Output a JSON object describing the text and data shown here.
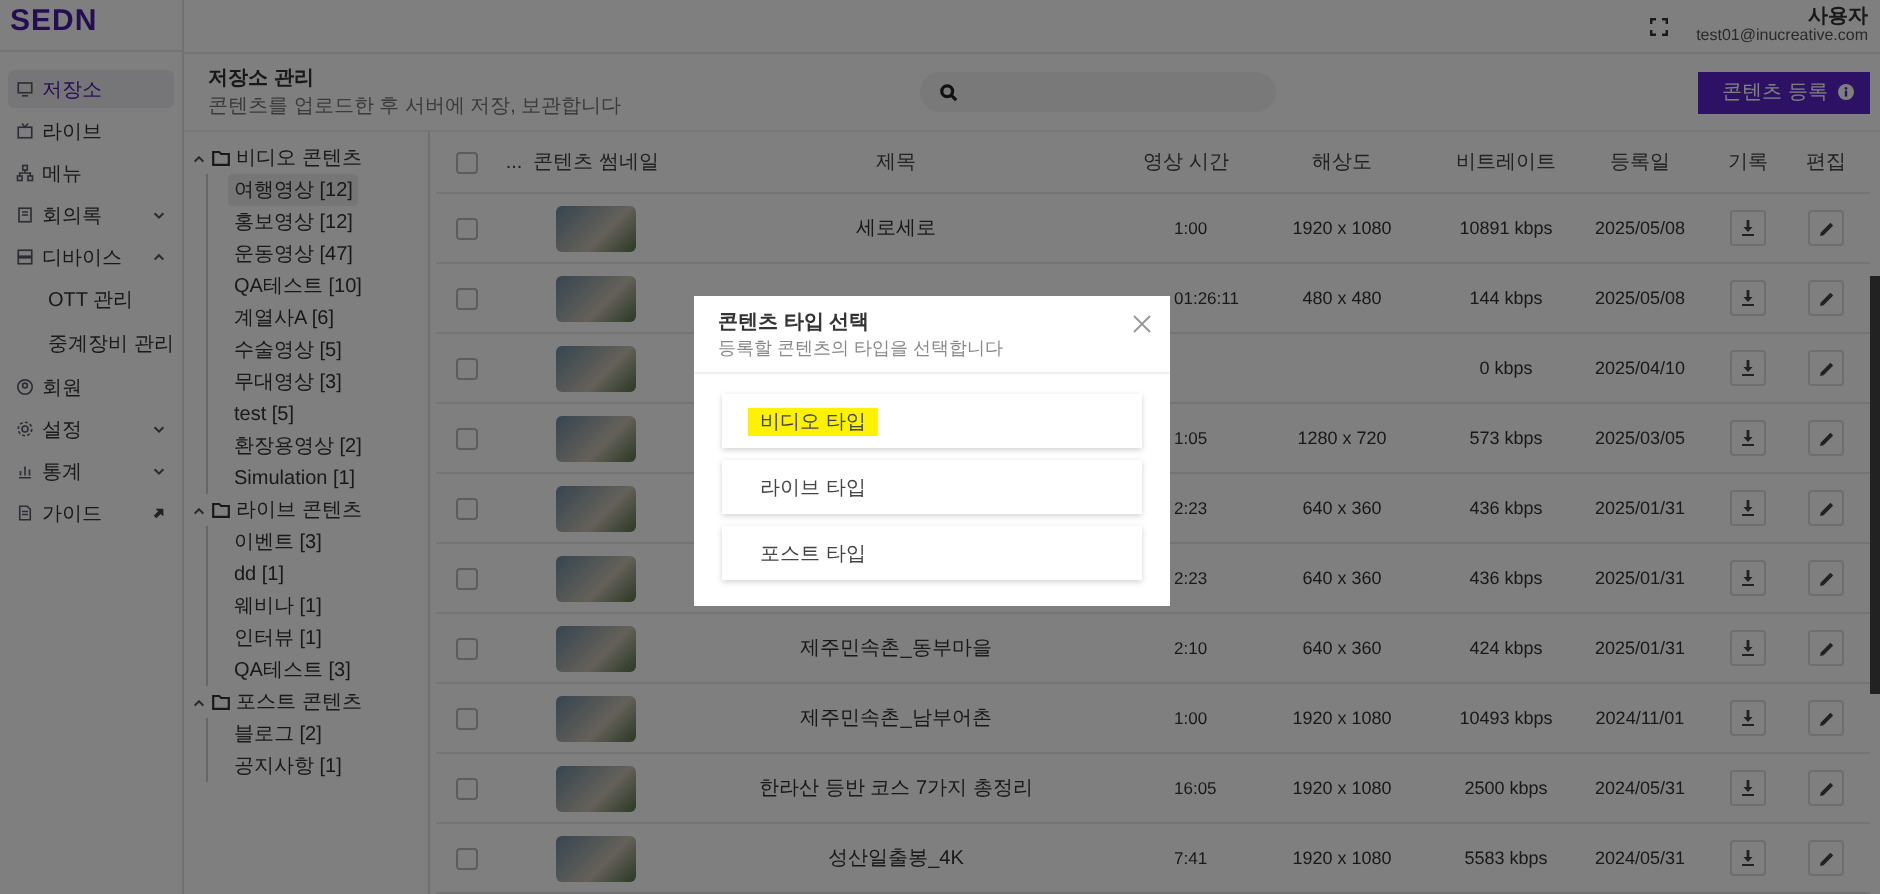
{
  "brand": {
    "logo": "SEDN"
  },
  "header": {
    "user_name": "사용자",
    "user_email": "test01@inucreative.com"
  },
  "sidebar": {
    "items": [
      {
        "kind": "page",
        "label": "저장소",
        "selected": true
      },
      {
        "kind": "page",
        "label": "라이브",
        "selected": false
      },
      {
        "kind": "page",
        "label": "메뉴",
        "selected": false
      },
      {
        "kind": "group",
        "label": "회의록",
        "selected": false,
        "expanded": false
      },
      {
        "kind": "group",
        "label": "디바이스",
        "selected": false,
        "expanded": true,
        "children": [
          {
            "label": "OTT 관리",
            "selected": false
          },
          {
            "label": "중계장비 관리",
            "selected": false
          }
        ]
      },
      {
        "kind": "page",
        "label": "회원",
        "selected": false
      },
      {
        "kind": "group",
        "label": "설정",
        "selected": false,
        "expanded": false
      },
      {
        "kind": "group",
        "label": "통계",
        "selected": false,
        "expanded": false
      },
      {
        "kind": "external",
        "label": "가이드",
        "selected": false
      }
    ]
  },
  "page": {
    "title": "저장소 관리",
    "subtitle": "콘텐츠를 업로드한 후 서버에 저장, 보관합니다",
    "register_button": "콘텐츠 등록"
  },
  "tree": [
    {
      "label": "비디오 콘텐츠",
      "expanded": true,
      "children": [
        {
          "label": "여행영상 [12]",
          "selected": true
        },
        {
          "label": "홍보영상 [12]",
          "selected": false
        },
        {
          "label": "운동영상 [47]",
          "selected": false
        },
        {
          "label": "QA테스트 [10]",
          "selected": false
        },
        {
          "label": "계열사A [6]",
          "selected": false
        },
        {
          "label": "수술영상 [5]",
          "selected": false
        },
        {
          "label": "무대영상 [3]",
          "selected": false
        },
        {
          "label": "test [5]",
          "selected": false
        },
        {
          "label": "환장용영상 [2]",
          "selected": false
        },
        {
          "label": "Simulation [1]",
          "selected": false
        }
      ]
    },
    {
      "label": "라이브 콘텐츠",
      "expanded": true,
      "children": [
        {
          "label": "이벤트 [3]",
          "selected": false
        },
        {
          "label": "dd [1]",
          "selected": false
        },
        {
          "label": "웨비나 [1]",
          "selected": false
        },
        {
          "label": "인터뷰 [1]",
          "selected": false
        },
        {
          "label": "QA테스트 [3]",
          "selected": false
        }
      ]
    },
    {
      "label": "포스트 콘텐츠",
      "expanded": true,
      "children": [
        {
          "label": "블로그 [2]",
          "selected": false
        },
        {
          "label": "공지사항 [1]",
          "selected": false
        }
      ]
    }
  ],
  "table": {
    "all_checked": false,
    "columns": [
      "...",
      "콘텐츠 썸네일",
      "제목",
      "영상 시간",
      "해상도",
      "비트레이트",
      "등록일",
      "기록",
      "편집"
    ],
    "rows": [
      {
        "checked": false,
        "title": "세로세로",
        "duration": "1:00",
        "resolution": "1920 x 1080",
        "bitrate": "10891 kbps",
        "date": "2025/05/08"
      },
      {
        "checked": false,
        "duration": "01:26:11",
        "resolution": "480 x 480",
        "bitrate": "144 kbps",
        "date": "2025/05/08"
      },
      {
        "checked": false,
        "bitrate": "0 kbps",
        "date": "2025/04/10"
      },
      {
        "checked": false,
        "duration": "1:05",
        "resolution": "1280 x 720",
        "bitrate": "573 kbps",
        "date": "2025/03/05"
      },
      {
        "checked": false,
        "duration": "2:23",
        "resolution": "640 x 360",
        "bitrate": "436 kbps",
        "date": "2025/01/31"
      },
      {
        "checked": false,
        "duration": "2:23",
        "resolution": "640 x 360",
        "bitrate": "436 kbps",
        "date": "2025/01/31"
      },
      {
        "checked": false,
        "title": "제주민속촌_동부마을",
        "duration": "2:10",
        "resolution": "640 x 360",
        "bitrate": "424 kbps",
        "date": "2025/01/31"
      },
      {
        "checked": false,
        "title": "제주민속촌_남부어촌",
        "duration": "1:00",
        "resolution": "1920 x 1080",
        "bitrate": "10493 kbps",
        "date": "2024/11/01"
      },
      {
        "checked": false,
        "title": "한라산 등반 코스 7가지 총정리",
        "duration": "16:05",
        "resolution": "1920 x 1080",
        "bitrate": "2500 kbps",
        "date": "2024/05/31"
      },
      {
        "checked": false,
        "title": "성산일출봉_4K",
        "duration": "7:41",
        "resolution": "1920 x 1080",
        "bitrate": "5583 kbps",
        "date": "2024/05/31"
      }
    ]
  },
  "modal": {
    "title": "콘텐츠 타입 선택",
    "subtitle": "등록할 콘텐츠의 타입을 선택합니다",
    "options": [
      {
        "label": "비디오 타입",
        "highlighted": true
      },
      {
        "label": "라이브 타입",
        "highlighted": false
      },
      {
        "label": "포스트 타입",
        "highlighted": false
      }
    ]
  }
}
